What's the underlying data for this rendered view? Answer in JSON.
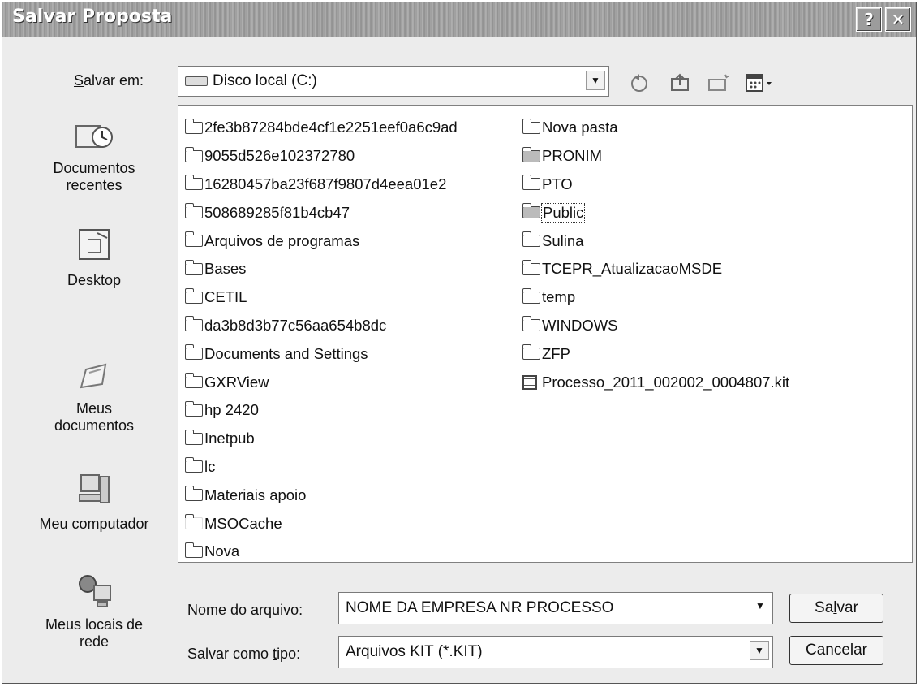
{
  "window": {
    "title": "Salvar Proposta"
  },
  "save_in": {
    "label_prefix": "",
    "label_underlined": "S",
    "label_rest": "alvar em:",
    "value": "Disco local (C:)"
  },
  "sidebar": {
    "items": [
      {
        "line1": "Documentos",
        "line2": "recentes"
      },
      {
        "line1": "Desktop",
        "line2": ""
      },
      {
        "line1": "Meus",
        "line2": "documentos"
      },
      {
        "line1": "Meu computador",
        "line2": ""
      },
      {
        "line1": "Meus locais de",
        "line2": "rede"
      }
    ]
  },
  "files": {
    "column1": [
      "2fe3b87284bde4cf1e2251eef0a6c9ad",
      "9055d526e102372780",
      "16280457ba23f687f9807d4eea01e2",
      "508689285f81b4cb47",
      "Arquivos de programas",
      "Bases",
      "CETIL",
      "da3b8d3b77c56aa654b8dc",
      "Documents and Settings",
      "GXRView",
      "hp 2420",
      "Inetpub",
      "lc",
      "Materiais apoio",
      "MSOCache",
      "Nova"
    ],
    "column2": [
      "Nova pasta",
      "PRONIM",
      "PTO",
      "Public",
      "Sulina",
      "TCEPR_AtualizacaoMSDE",
      "temp",
      "WINDOWS",
      "ZFP",
      "Processo_2011_002002_0004807.kit"
    ]
  },
  "filename": {
    "label_underlined": "N",
    "label_rest": "ome do arquivo:",
    "value": "NOME DA EMPRESA NR PROCESSO"
  },
  "filetype": {
    "label_prefix": "Salvar como ",
    "label_underlined": "t",
    "label_rest": "ipo:",
    "value": "Arquivos KIT (*.KIT)"
  },
  "buttons": {
    "save_prefix": "Sa",
    "save_underlined": "l",
    "save_rest": "var",
    "cancel": "Cancelar"
  },
  "icons": {
    "help": "?",
    "close": "✕",
    "dropdown": "▼"
  }
}
